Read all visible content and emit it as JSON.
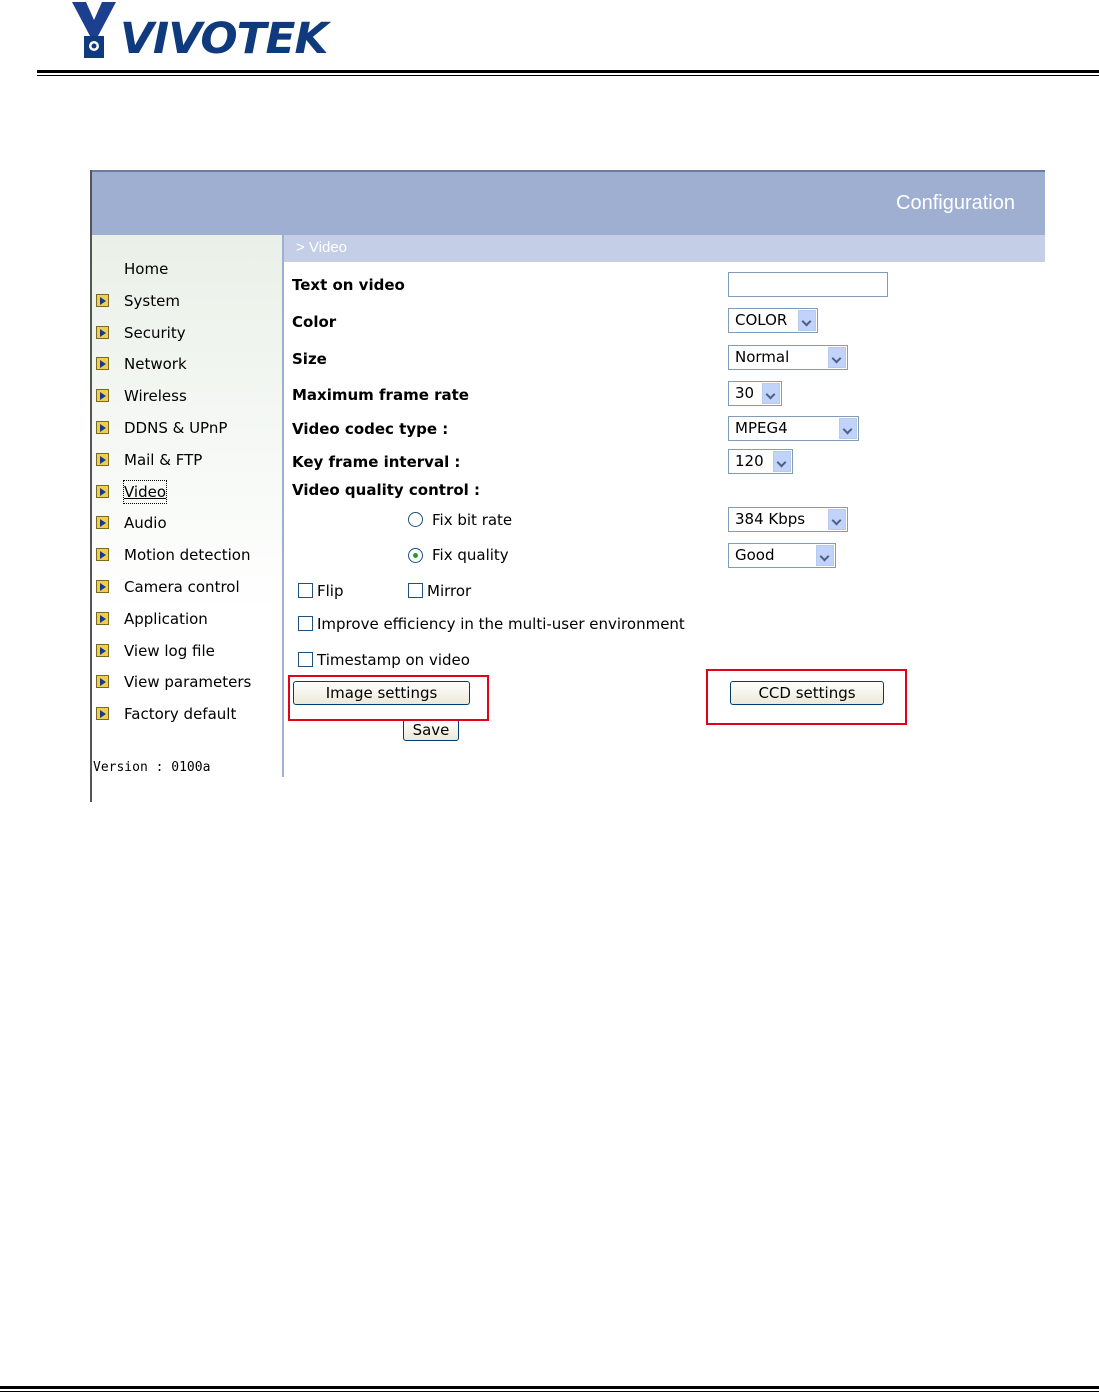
{
  "brand": {
    "name": "VIVOTEK"
  },
  "header": {
    "title": "Configuration"
  },
  "breadcrumb": "> Video",
  "sidebar": {
    "items": [
      {
        "label": "Home",
        "arrow": false
      },
      {
        "label": "System",
        "arrow": true
      },
      {
        "label": "Security",
        "arrow": true
      },
      {
        "label": "Network",
        "arrow": true
      },
      {
        "label": "Wireless",
        "arrow": true
      },
      {
        "label": "DDNS & UPnP",
        "arrow": true
      },
      {
        "label": "Mail & FTP",
        "arrow": true
      },
      {
        "label": "Video",
        "arrow": true,
        "selected": true
      },
      {
        "label": "Audio",
        "arrow": true
      },
      {
        "label": "Motion detection",
        "arrow": true
      },
      {
        "label": "Camera control",
        "arrow": true
      },
      {
        "label": "Application",
        "arrow": true
      },
      {
        "label": "View log file",
        "arrow": true
      },
      {
        "label": "View parameters",
        "arrow": true
      },
      {
        "label": "Factory default",
        "arrow": true
      }
    ],
    "version": "Version : 0100a"
  },
  "form": {
    "text_on_video": {
      "label": "Text on video",
      "value": ""
    },
    "color": {
      "label": "Color",
      "value": "COLOR"
    },
    "size": {
      "label": "Size",
      "value": "Normal"
    },
    "max_frame_rate": {
      "label": "Maximum frame rate",
      "value": "30"
    },
    "codec": {
      "label": "Video codec type :",
      "value": "MPEG4"
    },
    "key_frame": {
      "label": "Key frame interval :",
      "value": "120"
    },
    "quality_control": {
      "label": "Video quality control :"
    },
    "fix_bit_rate": {
      "label": "Fix bit rate",
      "selected": false,
      "value": "384 Kbps"
    },
    "fix_quality": {
      "label": "Fix quality",
      "selected": true,
      "value": "Good"
    },
    "flip": {
      "label": "Flip",
      "checked": false
    },
    "mirror": {
      "label": "Mirror",
      "checked": false
    },
    "improve_efficiency": {
      "label": "Improve efficiency in the multi-user environment",
      "checked": false
    },
    "timestamp": {
      "label": "Timestamp on video",
      "checked": false
    },
    "image_settings_button": "Image settings",
    "ccd_settings_button": "CCD settings",
    "save_button": "Save"
  },
  "colors": {
    "header": "#9fafd1",
    "breadcrumb": "#c4cfe7",
    "highlight": "#e3001b",
    "brand": "#0f3a7d"
  }
}
